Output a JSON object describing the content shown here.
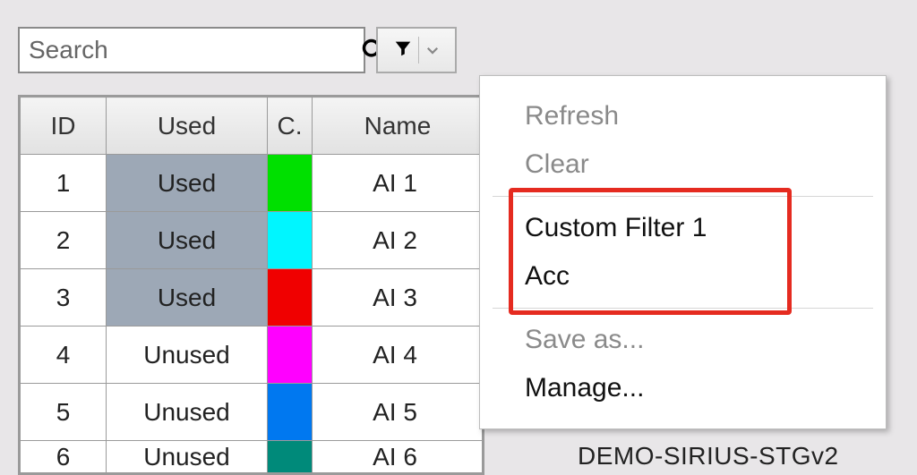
{
  "search": {
    "placeholder": "Search"
  },
  "table": {
    "headers": {
      "id": "ID",
      "used": "Used",
      "c": "C.",
      "name": "Name"
    },
    "rows": [
      {
        "id": "1",
        "used": "Used",
        "usedBg": true,
        "color": "#00e000",
        "name": "AI 1"
      },
      {
        "id": "2",
        "used": "Used",
        "usedBg": true,
        "color": "#00f6ff",
        "name": "AI 2"
      },
      {
        "id": "3",
        "used": "Used",
        "usedBg": true,
        "color": "#f00000",
        "name": "AI 3"
      },
      {
        "id": "4",
        "used": "Unused",
        "usedBg": false,
        "color": "#ff00ff",
        "name": "AI 4"
      },
      {
        "id": "5",
        "used": "Unused",
        "usedBg": false,
        "color": "#0078f0",
        "name": "AI 5"
      },
      {
        "id": "6",
        "used": "Unused",
        "usedBg": false,
        "color": "#008a7a",
        "name": "AI 6"
      }
    ]
  },
  "menu": {
    "refresh": "Refresh",
    "clear": "Clear",
    "custom1": "Custom Filter 1",
    "custom2": "Acc",
    "saveas": "Save as...",
    "manage": "Manage..."
  },
  "peek_text": "DEMO-SIRIUS-STGv2"
}
